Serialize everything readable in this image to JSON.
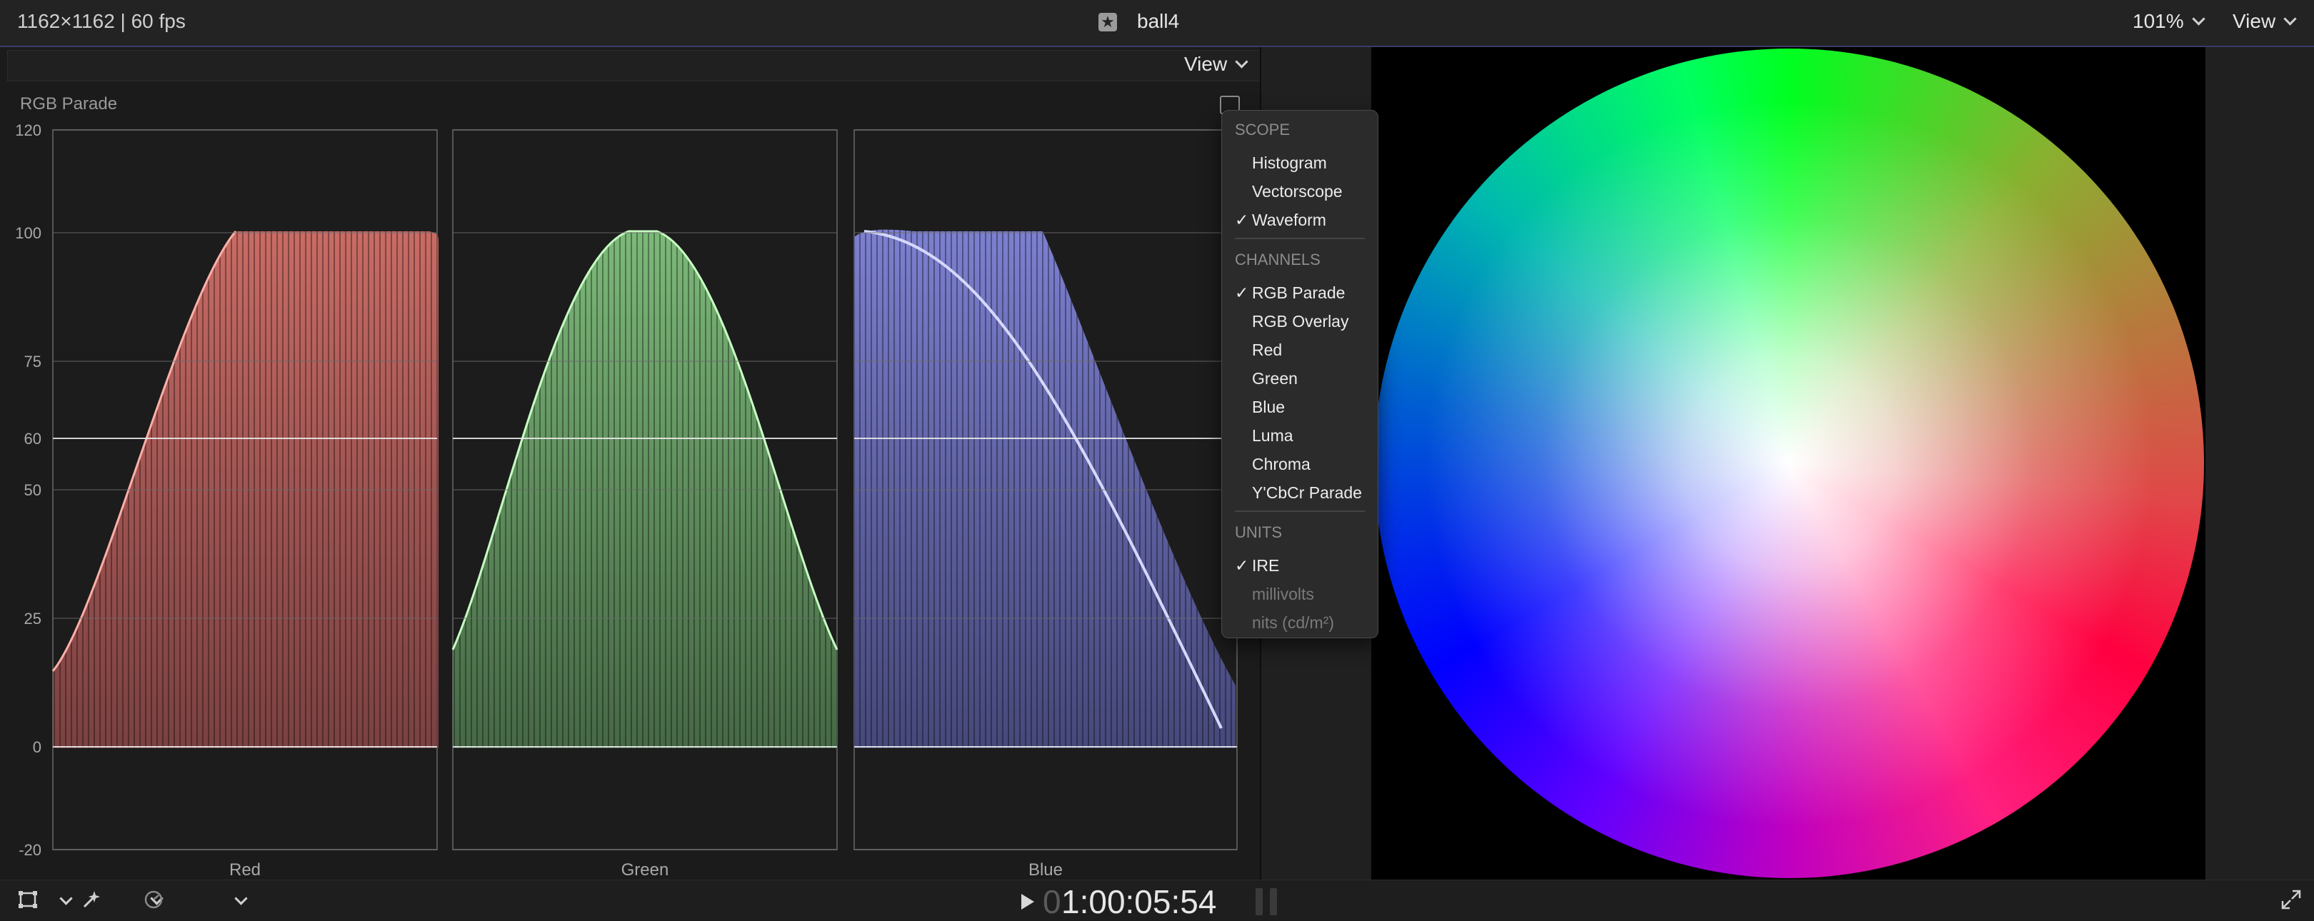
{
  "topbar": {
    "format": "1162×1162 | 60 fps",
    "clip_badge": "★",
    "clip_name": "ball4",
    "zoom": "101%",
    "view": "View"
  },
  "scope": {
    "view": "View",
    "title": "RGB Parade",
    "y_labels": [
      "120",
      "100",
      "75",
      "60",
      "50",
      "25",
      "0",
      "-20"
    ],
    "channels": [
      "Red",
      "Green",
      "Blue"
    ],
    "colors": {
      "red": "#e87a72",
      "green": "#8ed68a",
      "blue": "#8e92f0"
    }
  },
  "menu": {
    "scope_header": "SCOPE",
    "scope_items": [
      {
        "label": "Histogram",
        "checked": false
      },
      {
        "label": "Vectorscope",
        "checked": false
      },
      {
        "label": "Waveform",
        "checked": true
      }
    ],
    "channels_header": "CHANNELS",
    "channel_items": [
      {
        "label": "RGB Parade",
        "checked": true
      },
      {
        "label": "RGB Overlay",
        "checked": false
      },
      {
        "label": "Red",
        "checked": false
      },
      {
        "label": "Green",
        "checked": false
      },
      {
        "label": "Blue",
        "checked": false
      },
      {
        "label": "Luma",
        "checked": false
      },
      {
        "label": "Chroma",
        "checked": false
      },
      {
        "label": "Y'CbCr Parade",
        "checked": false
      }
    ],
    "units_header": "UNITS",
    "unit_items": [
      {
        "label": "IRE",
        "checked": true,
        "disabled": false
      },
      {
        "label": "millivolts",
        "checked": false,
        "disabled": true
      },
      {
        "label": "nits (cd/m²)",
        "checked": false,
        "disabled": true
      }
    ],
    "check_mark": "✓"
  },
  "bottombar": {
    "timecode_dim": "0",
    "timecode": "1:00:05:54"
  },
  "icons": [
    "transform-icon",
    "enhance-wand-icon",
    "speed-icon",
    "play-icon",
    "fullscreen-icon"
  ]
}
